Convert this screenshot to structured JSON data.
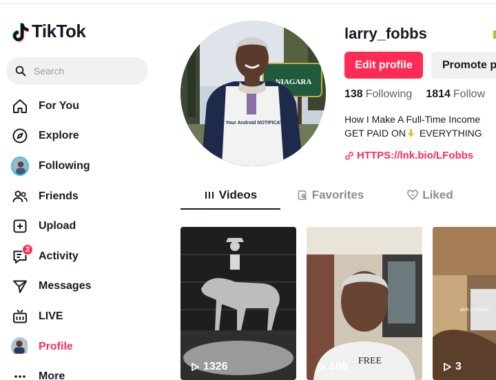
{
  "app": {
    "name": "TikTok"
  },
  "search": {
    "placeholder": "Search"
  },
  "nav": [
    {
      "label": "For You",
      "icon": "home-icon"
    },
    {
      "label": "Explore",
      "icon": "compass-icon"
    },
    {
      "label": "Following",
      "icon": "following-avatar"
    },
    {
      "label": "Friends",
      "icon": "friends-icon"
    },
    {
      "label": "Upload",
      "icon": "upload-icon"
    },
    {
      "label": "Activity",
      "icon": "activity-icon",
      "badge": "2"
    },
    {
      "label": "Messages",
      "icon": "messages-icon"
    },
    {
      "label": "LIVE",
      "icon": "live-icon"
    },
    {
      "label": "Profile",
      "icon": "profile-avatar",
      "active": true
    },
    {
      "label": "More",
      "icon": "more-icon"
    }
  ],
  "profile": {
    "username": "larry_fobbs",
    "edit_label": "Edit profile",
    "promote_label": "Promote p",
    "following_count": "138",
    "following_label": "Following",
    "followers_count": "1814",
    "followers_label": "Follow",
    "bio_line1": "How I Make A Full-Time Income",
    "bio_line2_a": "GET PAID ON",
    "bio_line2_b": " EVERYTHING",
    "link": "HTTPS://lnk.bio/LFobbs",
    "shirt_text": "Check Your Android NOTIFICATIONS",
    "sign_text": "NIAGARA"
  },
  "tabs": [
    {
      "label": "Videos",
      "icon": "grid-icon",
      "active": true
    },
    {
      "label": "Favorites",
      "icon": "bookmark-icon"
    },
    {
      "label": "Liked",
      "icon": "heart-icon"
    }
  ],
  "videos": [
    {
      "views": "1326"
    },
    {
      "views": "106",
      "overlay": "FREE"
    },
    {
      "views": "3",
      "overlay": "pick a historic"
    }
  ],
  "colors": {
    "accent": "#fe2c55",
    "text": "#161823",
    "muted": "#8a8b91"
  }
}
